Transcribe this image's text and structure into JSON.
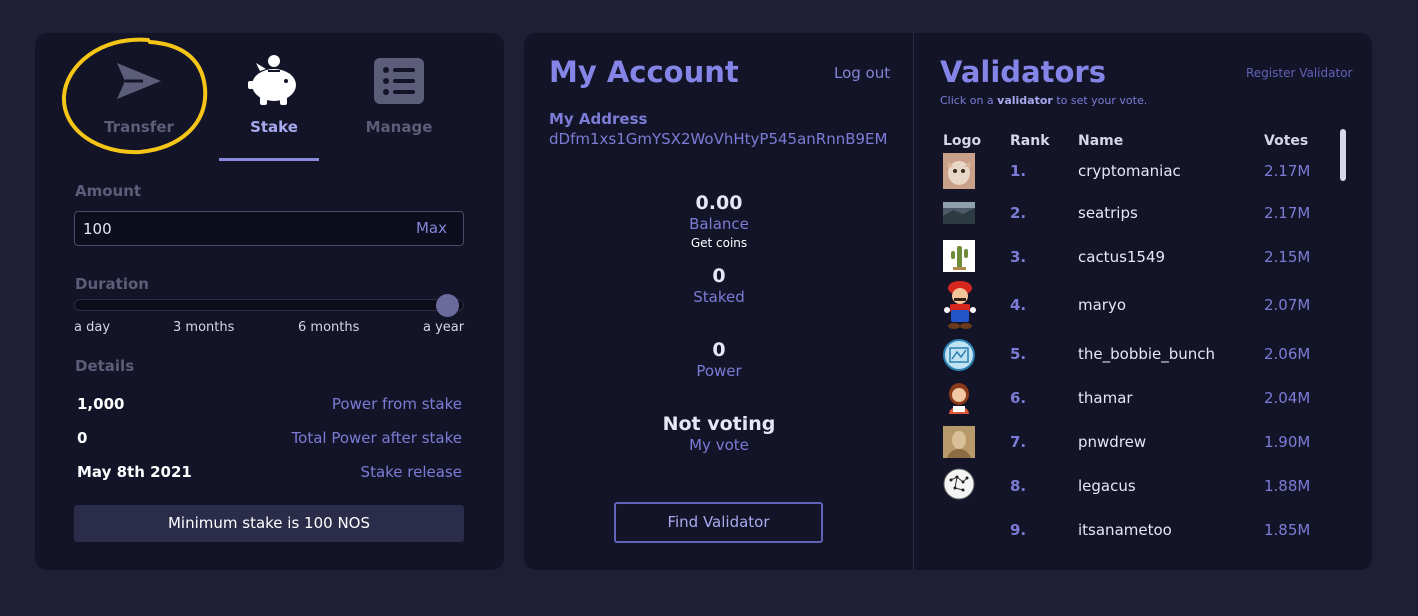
{
  "tabs": [
    {
      "label": "Transfer",
      "icon": "send-icon"
    },
    {
      "label": "Stake",
      "icon": "piggy-bank-icon",
      "active": true
    },
    {
      "label": "Manage",
      "icon": "list-icon"
    }
  ],
  "stake": {
    "amount_label": "Amount",
    "amount_value": "100",
    "max_label": "Max",
    "duration_label": "Duration",
    "duration_ticks": [
      "a day",
      "3 months",
      "6 months",
      "a year"
    ],
    "duration_selected": "a year",
    "details_label": "Details",
    "details": [
      {
        "value": "1,000",
        "label": "Power from stake"
      },
      {
        "value": "0",
        "label": "Total Power after stake"
      },
      {
        "value": "May 8th 2021",
        "label": "Stake release"
      }
    ],
    "min_notice": "Minimum stake is 100 NOS"
  },
  "account": {
    "title": "My Account",
    "logout_label": "Log out",
    "address_label": "My Address",
    "address": "dDfm1xs1GmYSX2WoVhHtyP545anRnnB9EM",
    "balance_value": "0.00",
    "balance_label": "Balance",
    "get_coins_label": "Get coins",
    "staked_value": "0",
    "staked_label": "Staked",
    "power_value": "0",
    "power_label": "Power",
    "vote_value": "Not voting",
    "vote_label": "My vote",
    "find_validator_label": "Find Validator"
  },
  "validators": {
    "title": "Validators",
    "register_label": "Register Validator",
    "hint_prefix": "Click on a ",
    "hint_bold": "validator",
    "hint_suffix": " to set your vote.",
    "columns": [
      "Logo",
      "Rank",
      "Name",
      "Votes"
    ],
    "rows": [
      {
        "rank": "1.",
        "name": "cryptomaniac",
        "votes": "2.17M",
        "logo": "cat-avatar"
      },
      {
        "rank": "2.",
        "name": "seatrips",
        "votes": "2.17M",
        "logo": "landscape-avatar"
      },
      {
        "rank": "3.",
        "name": "cactus1549",
        "votes": "2.15M",
        "logo": "cactus-avatar"
      },
      {
        "rank": "4.",
        "name": "maryo",
        "votes": "2.07M",
        "logo": "plumber-avatar"
      },
      {
        "rank": "5.",
        "name": "the_bobbie_bunch",
        "votes": "2.06M",
        "logo": "framed-avatar"
      },
      {
        "rank": "6.",
        "name": "thamar",
        "votes": "2.04M",
        "logo": "woman-avatar"
      },
      {
        "rank": "7.",
        "name": "pnwdrew",
        "votes": "1.90M",
        "logo": "portrait-avatar"
      },
      {
        "rank": "8.",
        "name": "legacus",
        "votes": "1.88M",
        "logo": "constellation-avatar"
      },
      {
        "rank": "9.",
        "name": "itsanametoo",
        "votes": "1.85M",
        "logo": ""
      }
    ]
  },
  "colors": {
    "background": "#1e1f36",
    "panel": "#131427",
    "accent": "#8585e8",
    "muted": "#5c5d79",
    "annotation": "#f5c518"
  }
}
